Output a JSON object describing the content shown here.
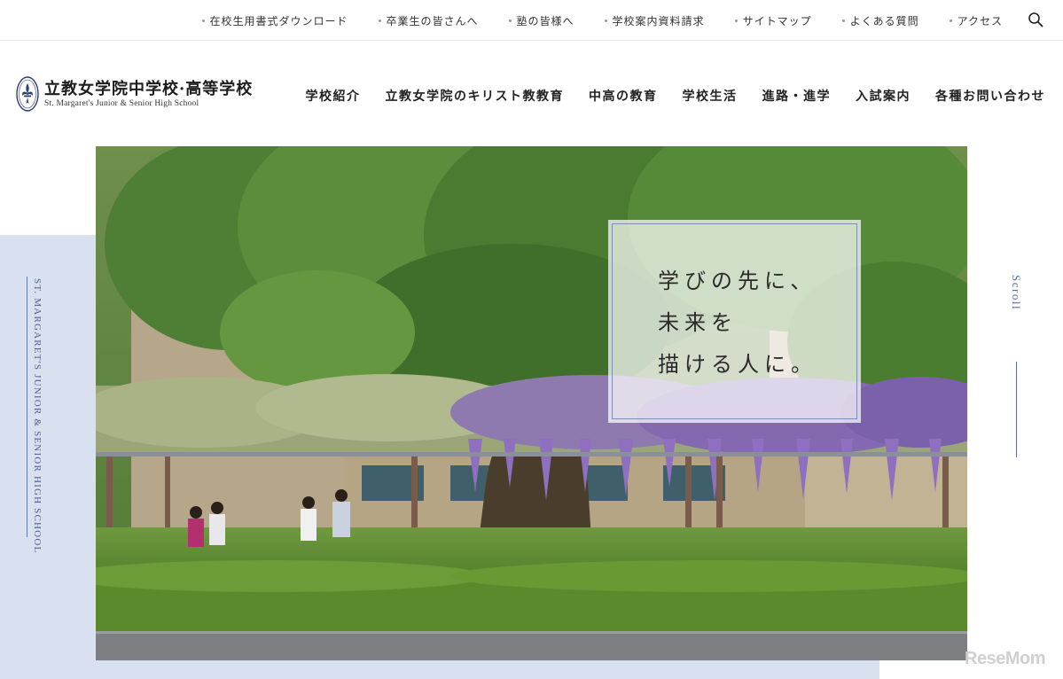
{
  "top_links": [
    "在校生用書式ダウンロード",
    "卒業生の皆さんへ",
    "塾の皆様へ",
    "学校案内資料請求",
    "サイトマップ",
    "よくある質問",
    "アクセス"
  ],
  "logo": {
    "name_jp": "立教女学院中学校·高等学校",
    "name_en": "St. Margaret's Junior & Senior High School"
  },
  "nav": [
    "学校紹介",
    "立教女学院のキリスト教教育",
    "中高の教育",
    "学校生活",
    "進路・進学",
    "入試案内",
    "各種お問い合わせ"
  ],
  "side_label": "ST. MARGARET'S JUNIOR & SENIOR HIGH SCHOOL",
  "hero": {
    "tagline_line1": "学びの先に、",
    "tagline_line2": "未来を",
    "tagline_line3": "描ける人に。"
  },
  "scroll_label": "Scroll",
  "watermark": "ReseMom",
  "colors": {
    "accent": "#5d6f99",
    "band": "#d9e1f0"
  },
  "icons": {
    "search": "search-icon",
    "crest": "fleur-de-lis-crest-icon"
  }
}
